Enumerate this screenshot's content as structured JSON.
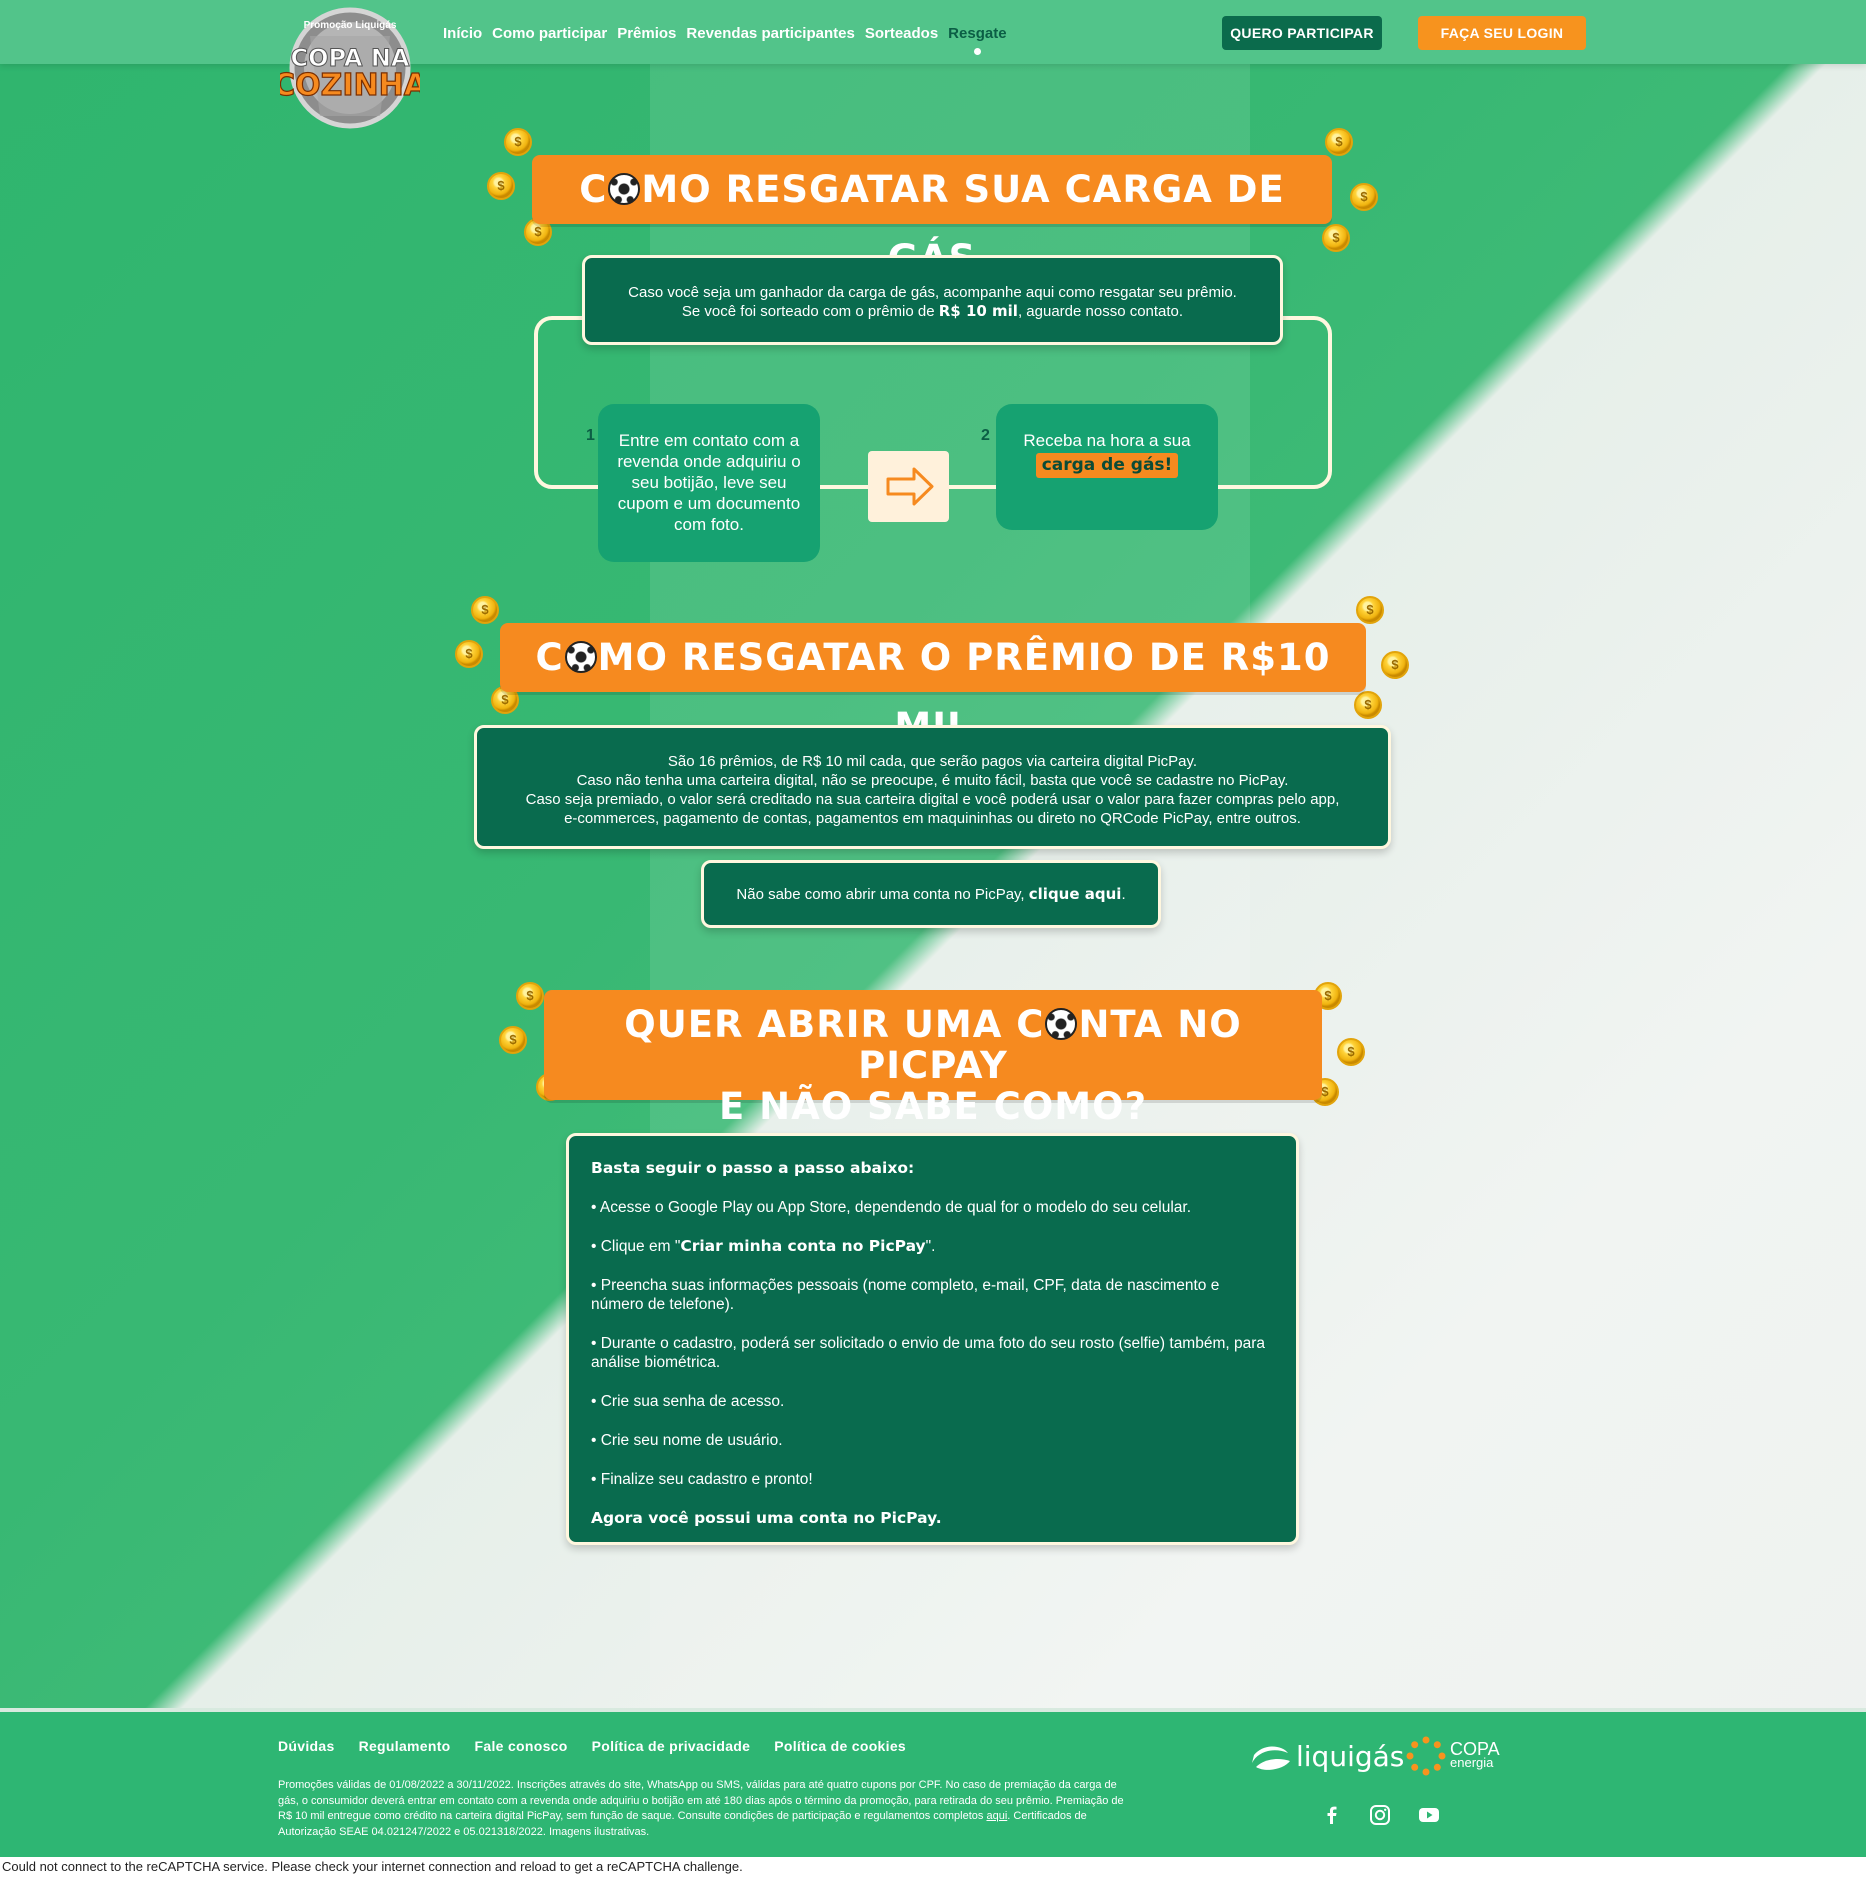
{
  "header": {
    "logo_top_text": "Promoção Liquigás",
    "logo_line1": "COPA NA",
    "logo_line2": "COZINHA",
    "nav": [
      "Início",
      "Como participar",
      "Prêmios",
      "Revendas participantes",
      "Sorteados",
      "Resgate"
    ],
    "nav_active": "Resgate",
    "cta_participate": "QUERO PARTICIPAR",
    "cta_login": "FAÇA SEU LOGIN"
  },
  "section_gas": {
    "title_before": "C",
    "title_after": "MO RESGATAR SUA CARGA DE GÁS",
    "intro_line1": "Caso você seja um ganhador da carga de gás, acompanhe aqui como resgatar seu prêmio.",
    "intro_line2_a": "Se você foi sorteado com o prêmio de ",
    "intro_line2_b": "R$ 10 mil",
    "intro_line2_c": ", aguarde nosso contato.",
    "step1_num": "1",
    "step1_text": "Entre em contato com a revenda onde adquiriu o seu botijão, leve seu cupom e um documento com foto.",
    "step2_num": "2",
    "step2_text": "Receba na hora a sua",
    "step2_highlight": "carga de gás!"
  },
  "section_prize": {
    "title_before": "C",
    "title_after": "MO RESGATAR O PRÊMIO DE R$10 MIL",
    "lines": [
      "São 16 prêmios, de R$ 10 mil cada, que serão pagos via carteira digital PicPay.",
      "Caso não tenha uma carteira digital, não se preocupe, é muito fácil, basta que você se cadastre no PicPay.",
      "Caso seja premiado, o valor será creditado na sua carteira digital e você poderá usar o valor para fazer compras pelo app,",
      "e-commerces, pagamento de contas, pagamentos em maquininhas ou direto no QRCode PicPay, entre outros."
    ],
    "picpay_text": "Não sabe como abrir uma conta no PicPay, ",
    "picpay_link": "clique aqui",
    "picpay_end": "."
  },
  "section_picpay": {
    "title_line1_before": "QUER ABRIR UMA C",
    "title_line1_after": "NTA NO PICPAY",
    "title_line2": "E NÃO SABE COMO?",
    "intro": "Basta seguir o passo a passo abaixo:",
    "step1": "• Acesse o Google Play ou App Store, dependendo de qual for o modelo do seu celular.",
    "step2_a": "• Clique em \"",
    "step2_b": "Criar minha conta no PicPay",
    "step2_c": "\".",
    "step3": "• Preencha suas informações pessoais (nome completo, e-mail, CPF, data de nascimento e número de telefone).",
    "step4": "• Durante o cadastro, poderá ser solicitado o envio de uma foto do seu rosto (selfie) também, para análise biométrica.",
    "step5": "• Crie sua senha de acesso.",
    "step6": "• Crie seu nome de usuário.",
    "step7": "• Finalize seu cadastro e pronto!",
    "outro": "Agora você possui uma conta no PicPay."
  },
  "footer": {
    "links": [
      "Dúvidas",
      "Regulamento",
      "Fale conosco",
      "Política de privacidade",
      "Política de cookies"
    ],
    "legal_a": "Promoções válidas de 01/08/2022 a 30/11/2022. Inscrições através do site, WhatsApp ou SMS, válidas para até quatro cupons por CPF. No caso de premiação da carga de gás, o consumidor deverá entrar em contato com a revenda onde adquiriu o botijão em até 180 dias após o término da promoção, para retirada do seu prêmio. Premiação de R$ 10 mil entregue como crédito na carteira digital PicPay, sem função de saque. Consulte condições de participação e regulamentos completos ",
    "legal_link": "aqui",
    "legal_b": ". Certificados de Autorização SEAE 04.021247/2022 e 05.021318/2022. Imagens ilustrativas.",
    "brand1": "liquigás",
    "brand2_line1": "COPA",
    "brand2_line2": "energia",
    "social": [
      "facebook-icon",
      "instagram-icon",
      "youtube-icon"
    ]
  },
  "recaptcha_error": "Could not connect to the reCAPTCHA service. Please check your internet connection and reload to get a reCAPTCHA challenge.",
  "colors": {
    "green_header": "#52c48a",
    "dark_green": "#096b4e",
    "orange": "#f68a1f",
    "footer_green": "#2eb673"
  }
}
